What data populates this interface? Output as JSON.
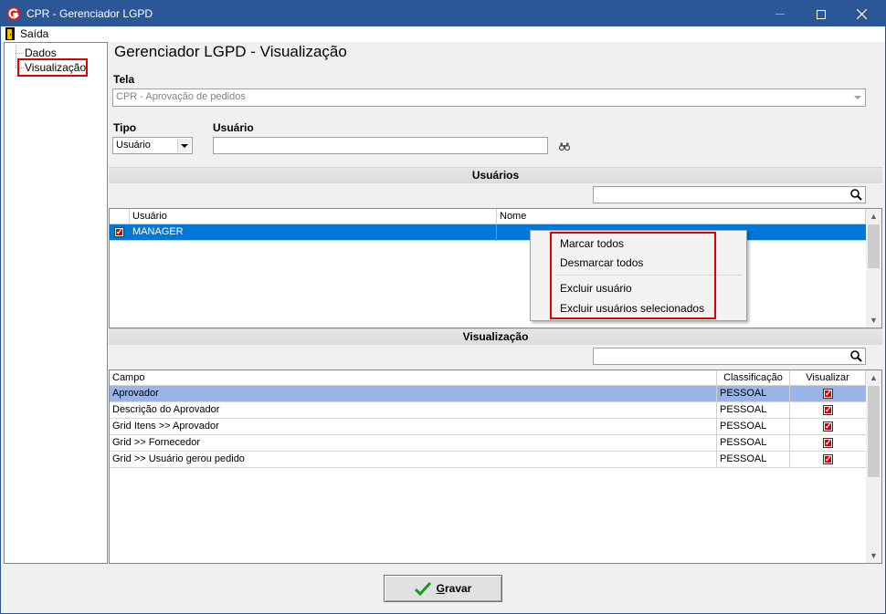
{
  "window": {
    "title": "CPR - Gerenciador LGPD",
    "minimize": "–",
    "maximize": "☐",
    "close": "✕"
  },
  "menu": {
    "exit_label": "Saída"
  },
  "tree": {
    "items": [
      {
        "label": "Dados"
      },
      {
        "label": "Visualização"
      }
    ]
  },
  "page": {
    "title": "Gerenciador LGPD - Visualização",
    "tela_label": "Tela",
    "tela_value": "CPR - Aprovação de pedidos",
    "tipo_label": "Tipo",
    "tipo_value": "Usuário",
    "usuario_label": "Usuário",
    "usuario_value": ""
  },
  "users_section": {
    "title": "Usuários",
    "search_value": "",
    "columns": [
      "Usuário",
      "Nome"
    ],
    "rows": [
      {
        "checked": true,
        "usuario": "MANAGER",
        "nome": ""
      }
    ]
  },
  "context_menu": {
    "items": [
      "Marcar todos",
      "Desmarcar todos",
      "Excluir usuário",
      "Excluir usuários selecionados"
    ]
  },
  "view_section": {
    "title": "Visualização",
    "search_value": "",
    "columns": [
      "Campo",
      "Classificação",
      "Visualizar"
    ],
    "rows": [
      {
        "campo": "Aprovador",
        "classificacao": "PESSOAL",
        "visualizar": true
      },
      {
        "campo": "Descrição do Aprovador",
        "classificacao": "PESSOAL",
        "visualizar": true
      },
      {
        "campo": "Grid  Itens >> Aprovador",
        "classificacao": "PESSOAL",
        "visualizar": true
      },
      {
        "campo": "Grid >> Fornecedor",
        "classificacao": "PESSOAL",
        "visualizar": true
      },
      {
        "campo": "Grid >> Usuário gerou pedido",
        "classificacao": "PESSOAL",
        "visualizar": true
      }
    ]
  },
  "buttons": {
    "save_label": "Gravar",
    "save_underline": "G",
    "save_rest": "ravar"
  },
  "colors": {
    "titlebar": "#2b5797",
    "selection": "#0078d7",
    "selection_row2": "#99b4e6",
    "highlight": "#e00000"
  }
}
